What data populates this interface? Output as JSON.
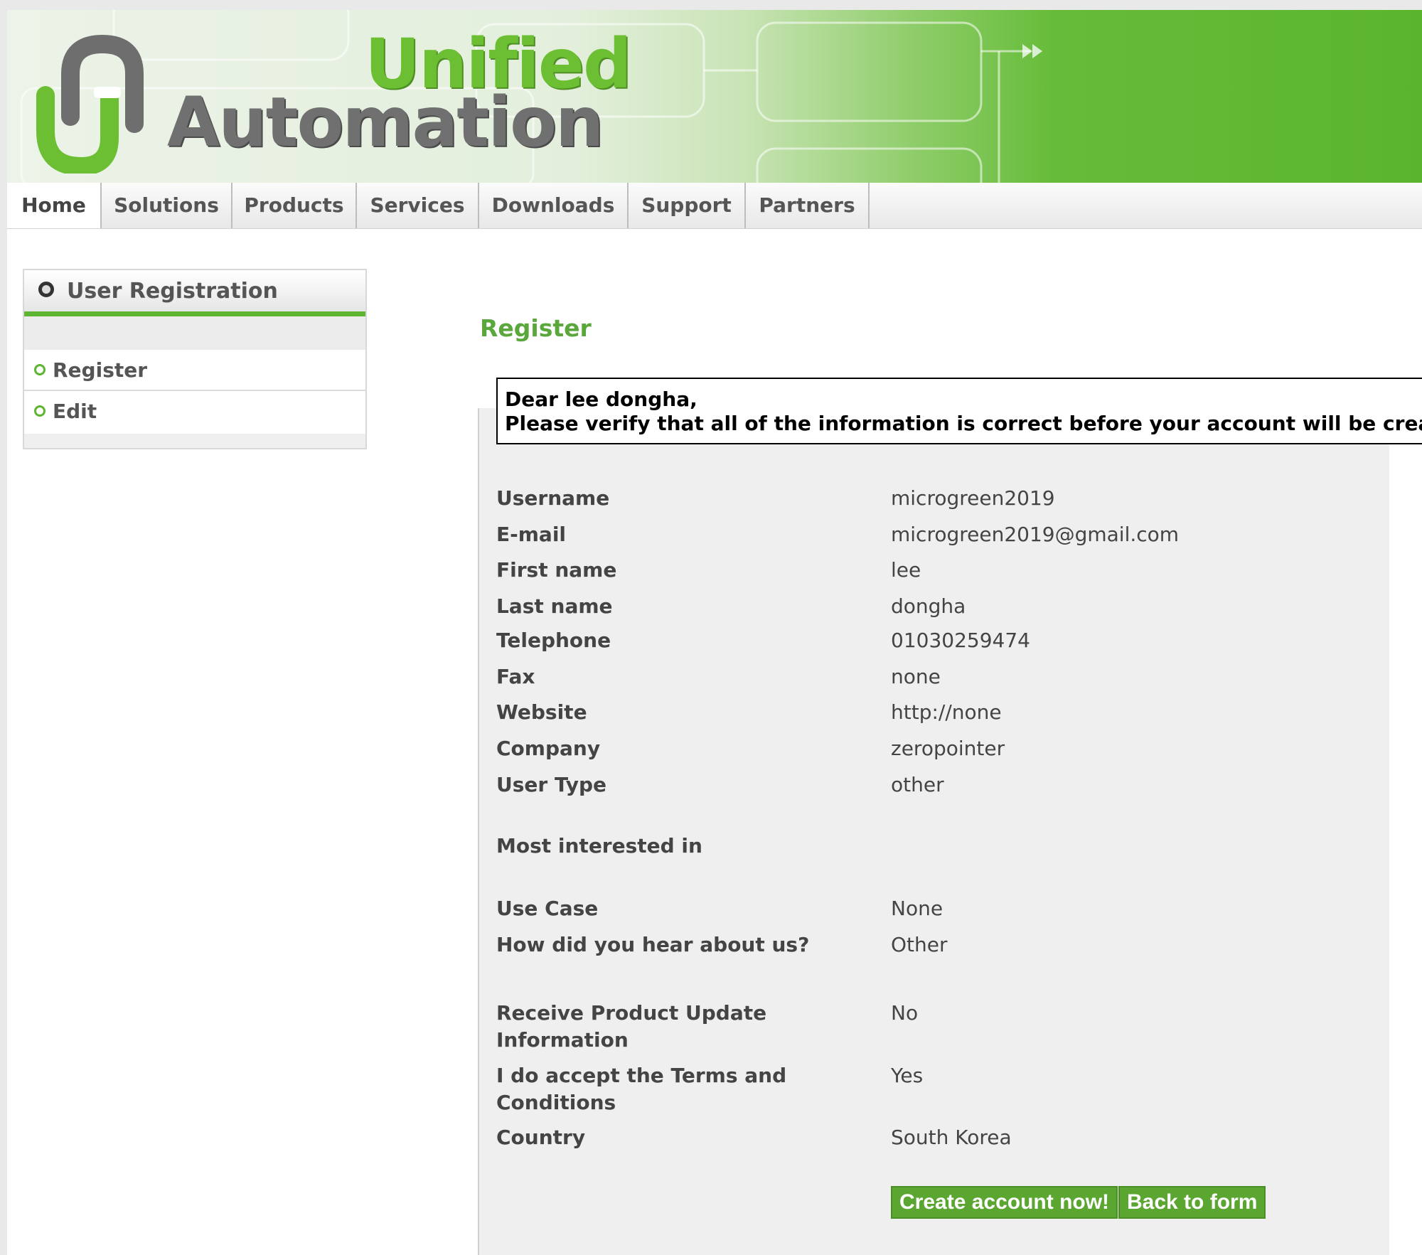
{
  "brand": {
    "line1": "Unified",
    "line2": "Automation"
  },
  "nav": [
    {
      "label": "Home"
    },
    {
      "label": "Solutions"
    },
    {
      "label": "Products"
    },
    {
      "label": "Services"
    },
    {
      "label": "Downloads"
    },
    {
      "label": "Support"
    },
    {
      "label": "Partners"
    }
  ],
  "sidebar": {
    "title": "User Registration",
    "items": [
      {
        "label": "Register"
      },
      {
        "label": "Edit"
      }
    ]
  },
  "main": {
    "title": "Register",
    "notice_line1": "Dear lee dongha,",
    "notice_line2": "Please verify that all of the information is correct before your account will be created:",
    "fields": [
      {
        "label": "Username",
        "value": "microgreen2019"
      },
      {
        "label": "E-mail",
        "value": "microgreen2019@gmail.com"
      },
      {
        "label": "First name",
        "value": "lee"
      },
      {
        "label": "Last name",
        "value": "dongha"
      },
      {
        "label": "Telephone",
        "value": "01030259474"
      },
      {
        "label": "Fax",
        "value": "none"
      },
      {
        "label": "Website",
        "value": "http://none"
      },
      {
        "label": "Company",
        "value": "zeropointer"
      },
      {
        "label": "User Type",
        "value": "other"
      },
      {
        "label": "Most interested in",
        "value": ""
      },
      {
        "label": "Use Case",
        "value": "None"
      },
      {
        "label": "How did you hear about us?",
        "value": "Other"
      },
      {
        "label": "Receive Product Update Information",
        "value": "No"
      },
      {
        "label": "I do accept the Terms and Conditions",
        "value": "Yes"
      },
      {
        "label": "Country",
        "value": "South Korea"
      }
    ],
    "create_button": "Create account now!",
    "back_button": "Back to form"
  },
  "colors": {
    "accent": "#5aa630",
    "title_green": "#5aa73b"
  }
}
